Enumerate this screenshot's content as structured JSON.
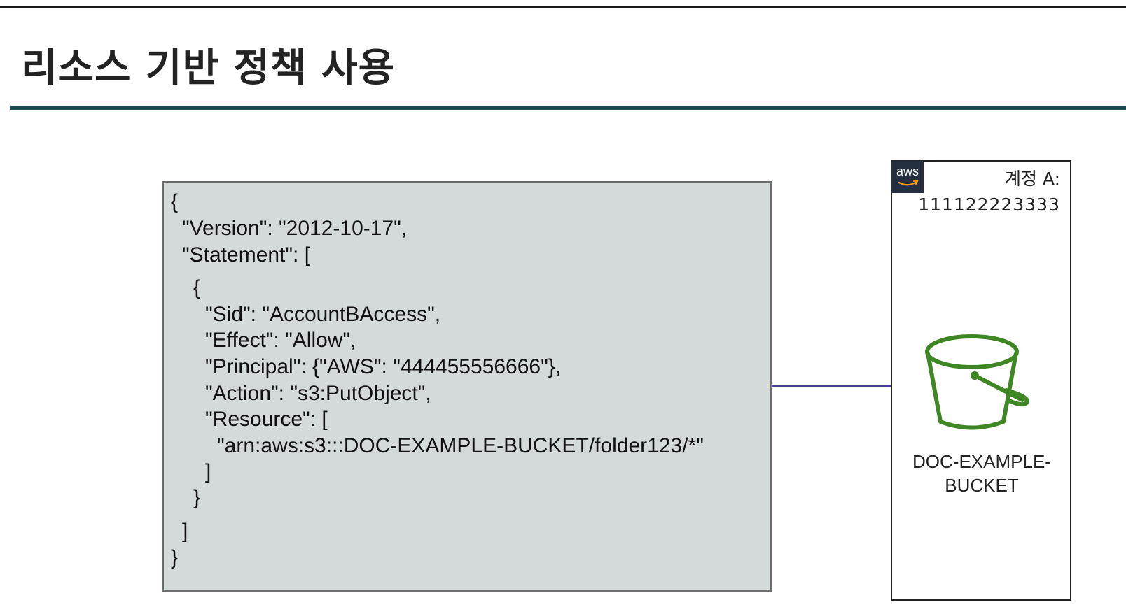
{
  "slide": {
    "title": "리소스 기반 정책 사용"
  },
  "policy": {
    "lines": [
      "{",
      "\"Version\": \"2012-10-17\",",
      "\"Statement\": [",
      "{",
      "\"Sid\": \"AccountBAccess\",",
      "\"Effect\": \"Allow\",",
      "\"Principal\": {\"AWS\": \"444455556666\"},",
      "\"Action\": \"s3:PutObject\",",
      "\"Resource\": [",
      "\"arn:aws:s3:::DOC-EXAMPLE-BUCKET/folder123/*\"",
      "]",
      "}",
      "]",
      "}"
    ]
  },
  "account": {
    "logo_text": "aws",
    "label": "계정 A:",
    "id": "111122223333",
    "bucket_name_line1": "DOC-EXAMPLE-",
    "bucket_name_line2": "BUCKET",
    "bucket_icon": "s3-bucket-icon"
  },
  "colors": {
    "title_rule": "#1f4a52",
    "policy_background": "#d4d9da",
    "arrow": "#4a3f9c",
    "bucket": "#3f8624",
    "aws_logo_bg": "#232f3e"
  }
}
